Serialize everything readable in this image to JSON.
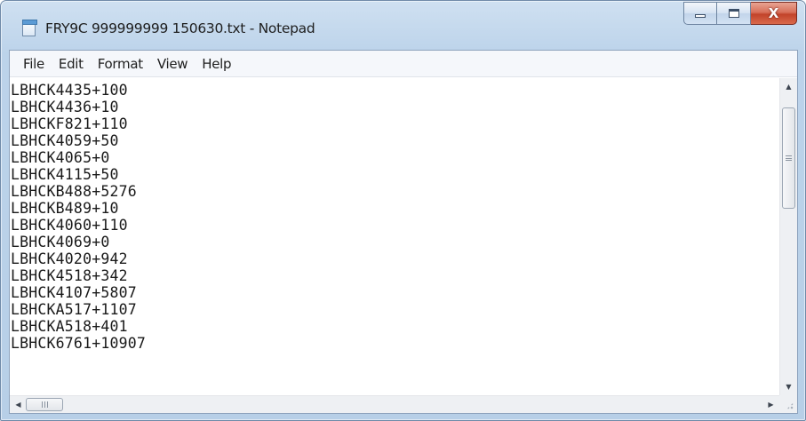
{
  "window": {
    "title": "FRY9C 999999999 150630.txt - Notepad"
  },
  "caption_buttons": {
    "minimize_icon": "minimize-icon",
    "maximize_icon": "maximize-icon",
    "close_icon": "close-icon",
    "close_glyph": "X"
  },
  "menu": {
    "items": [
      "File",
      "Edit",
      "Format",
      "View",
      "Help"
    ]
  },
  "editor": {
    "lines": [
      "LBHCK4435+100",
      "LBHCK4436+10",
      "LBHCKF821+110",
      "LBHCK4059+50",
      "LBHCK4065+0",
      "LBHCK4115+50",
      "LBHCKB488+5276",
      "LBHCKB489+10",
      "LBHCK4060+110",
      "LBHCK4069+0",
      "LBHCK4020+942",
      "LBHCK4518+342",
      "LBHCK4107+5807",
      "LBHCKA517+1107",
      "LBHCKA518+401",
      "LBHCK6761+10907"
    ]
  },
  "scrollbars": {
    "vertical_position": 0.0,
    "horizontal_position": 0.0,
    "up_arrow": "▲",
    "down_arrow": "▼",
    "left_arrow": "◀",
    "right_arrow": "▶"
  },
  "colors": {
    "title_bar": "#bcd3ea",
    "close_button": "#c2432a",
    "editor_background": "#ffffff",
    "text": "#1a1a1a"
  }
}
